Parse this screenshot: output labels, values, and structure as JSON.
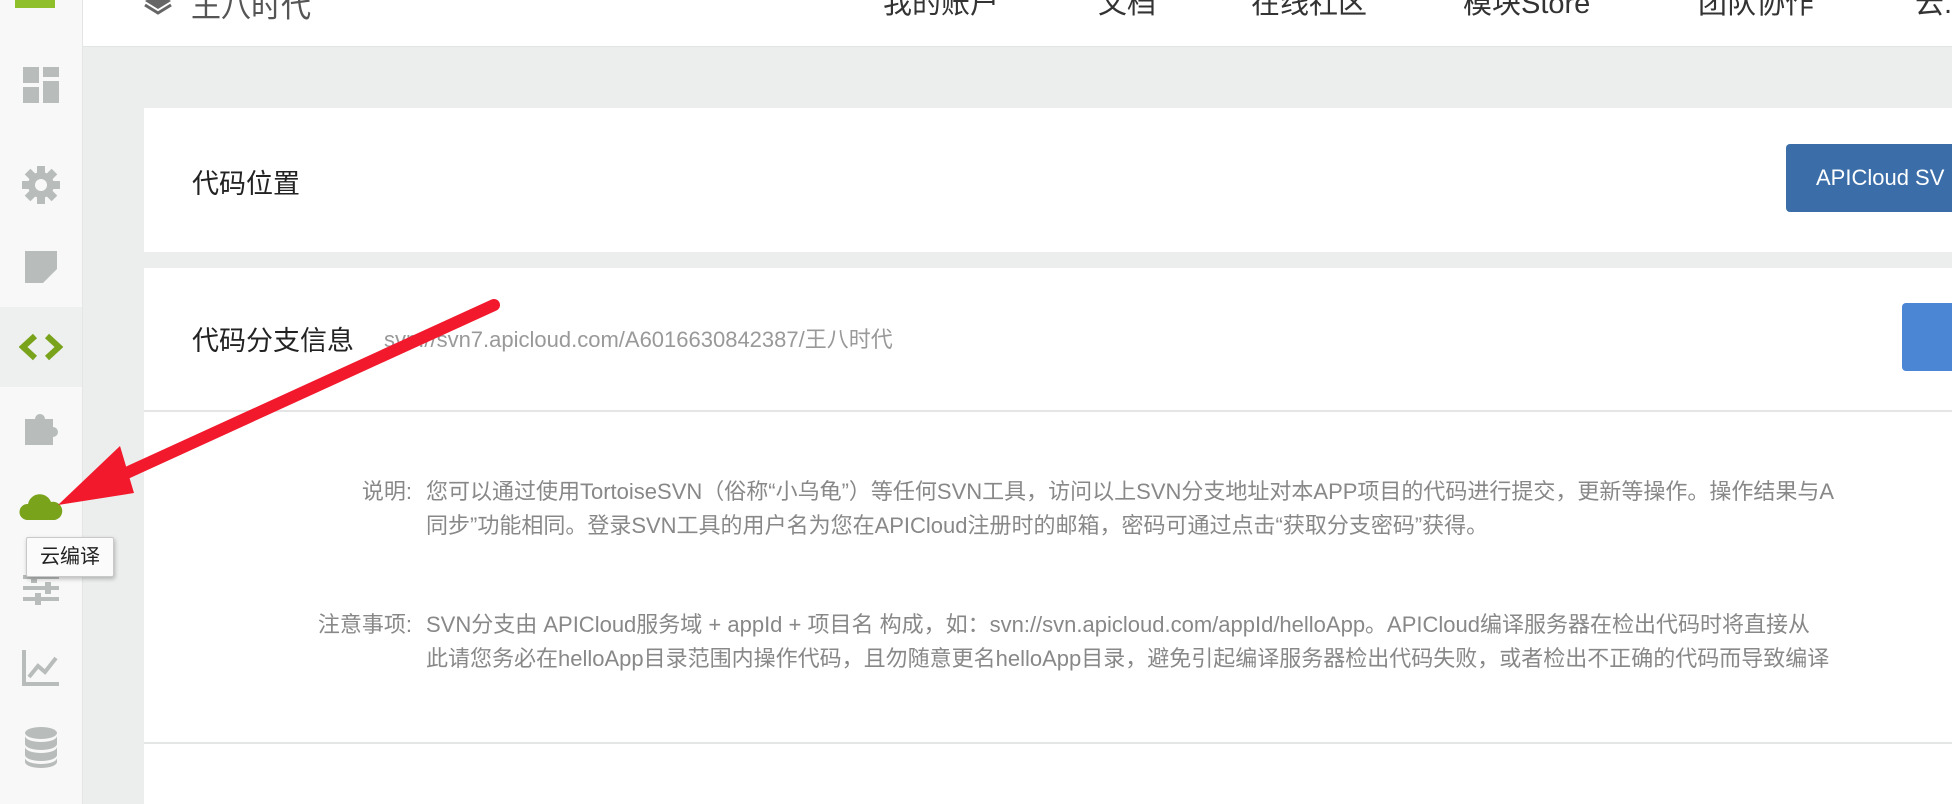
{
  "sidebar": {
    "tooltip": "云编译",
    "icons": [
      "dashboard-icon",
      "settings-gear-icon",
      "note-icon",
      "code-icon",
      "plugin-puzzle-icon",
      "cloud-icon",
      "sliders-icon",
      "chart-icon",
      "database-icon"
    ]
  },
  "header": {
    "app_name": "王八时代",
    "nav": [
      "我的账户",
      "文档",
      "在线社区",
      "模块Store",
      "团队协作",
      "云..."
    ]
  },
  "code_location": {
    "title": "代码位置",
    "button_label": "APICloud SV"
  },
  "branch": {
    "title": "代码分支信息",
    "url": "svn://svn7.apicloud.com/A6016630842387/王八时代"
  },
  "notes": {
    "explain_label": "说明:",
    "explain_line1": "您可以通过使用TortoiseSVN（俗称“小乌龟”）等任何SVN工具，访问以上SVN分支地址对本APP项目的代码进行提交，更新等操作。操作结果与A",
    "explain_line2": "同步”功能相同。登录SVN工具的用户名为您在APICloud注册时的邮箱，密码可通过点击“获取分支密码”获得。",
    "caution_label": "注意事项:",
    "caution_line1": "SVN分支由 APICloud服务域 + appId + 项目名 构成，如：svn://svn.apicloud.com/appId/helloApp。APICloud编译服务器在检出代码时将直接从",
    "caution_line2": "此请您务必在helloApp目录范围内操作代码，且勿随意更名helloApp目录，避免引起编译服务器检出代码失败，或者检出不正确的代码而导致编译"
  },
  "colors": {
    "accent_green": "#7aa31c",
    "icon_gray": "#b8bcbb",
    "button_blue": "#3b6ea8",
    "arrow_red": "#f2192c"
  }
}
